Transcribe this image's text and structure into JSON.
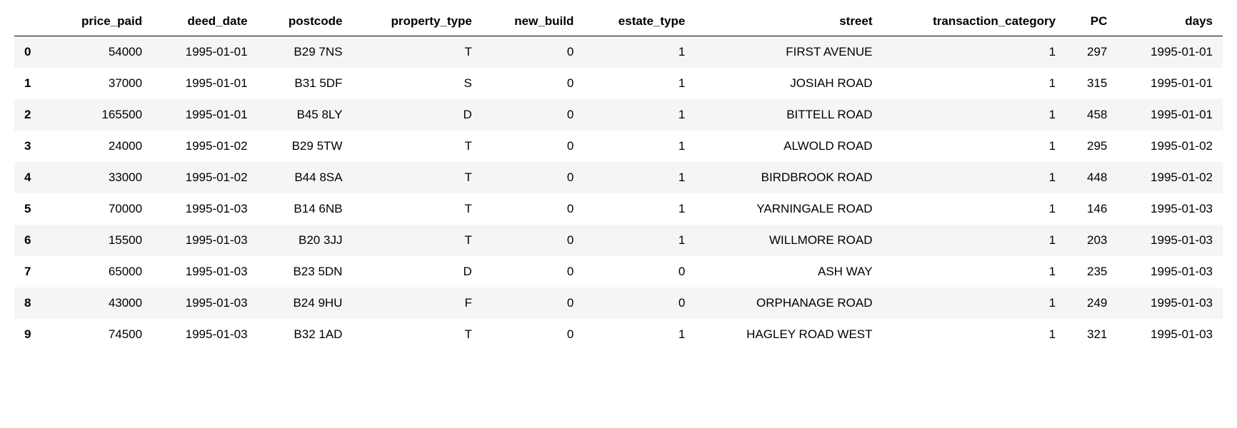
{
  "table": {
    "columns": [
      "",
      "price_paid",
      "deed_date",
      "postcode",
      "property_type",
      "new_build",
      "estate_type",
      "street",
      "transaction_category",
      "PC",
      "days"
    ],
    "rows": [
      {
        "idx": "0",
        "price_paid": "54000",
        "deed_date": "1995-01-01",
        "postcode": "B29 7NS",
        "property_type": "T",
        "new_build": "0",
        "estate_type": "1",
        "street": "FIRST AVENUE",
        "transaction_category": "1",
        "PC": "297",
        "days": "1995-01-01"
      },
      {
        "idx": "1",
        "price_paid": "37000",
        "deed_date": "1995-01-01",
        "postcode": "B31 5DF",
        "property_type": "S",
        "new_build": "0",
        "estate_type": "1",
        "street": "JOSIAH ROAD",
        "transaction_category": "1",
        "PC": "315",
        "days": "1995-01-01"
      },
      {
        "idx": "2",
        "price_paid": "165500",
        "deed_date": "1995-01-01",
        "postcode": "B45 8LY",
        "property_type": "D",
        "new_build": "0",
        "estate_type": "1",
        "street": "BITTELL ROAD",
        "transaction_category": "1",
        "PC": "458",
        "days": "1995-01-01"
      },
      {
        "idx": "3",
        "price_paid": "24000",
        "deed_date": "1995-01-02",
        "postcode": "B29 5TW",
        "property_type": "T",
        "new_build": "0",
        "estate_type": "1",
        "street": "ALWOLD ROAD",
        "transaction_category": "1",
        "PC": "295",
        "days": "1995-01-02"
      },
      {
        "idx": "4",
        "price_paid": "33000",
        "deed_date": "1995-01-02",
        "postcode": "B44 8SA",
        "property_type": "T",
        "new_build": "0",
        "estate_type": "1",
        "street": "BIRDBROOK ROAD",
        "transaction_category": "1",
        "PC": "448",
        "days": "1995-01-02"
      },
      {
        "idx": "5",
        "price_paid": "70000",
        "deed_date": "1995-01-03",
        "postcode": "B14 6NB",
        "property_type": "T",
        "new_build": "0",
        "estate_type": "1",
        "street": "YARNINGALE ROAD",
        "transaction_category": "1",
        "PC": "146",
        "days": "1995-01-03"
      },
      {
        "idx": "6",
        "price_paid": "15500",
        "deed_date": "1995-01-03",
        "postcode": "B20 3JJ",
        "property_type": "T",
        "new_build": "0",
        "estate_type": "1",
        "street": "WILLMORE ROAD",
        "transaction_category": "1",
        "PC": "203",
        "days": "1995-01-03"
      },
      {
        "idx": "7",
        "price_paid": "65000",
        "deed_date": "1995-01-03",
        "postcode": "B23 5DN",
        "property_type": "D",
        "new_build": "0",
        "estate_type": "0",
        "street": "ASH WAY",
        "transaction_category": "1",
        "PC": "235",
        "days": "1995-01-03"
      },
      {
        "idx": "8",
        "price_paid": "43000",
        "deed_date": "1995-01-03",
        "postcode": "B24 9HU",
        "property_type": "F",
        "new_build": "0",
        "estate_type": "0",
        "street": "ORPHANAGE ROAD",
        "transaction_category": "1",
        "PC": "249",
        "days": "1995-01-03"
      },
      {
        "idx": "9",
        "price_paid": "74500",
        "deed_date": "1995-01-03",
        "postcode": "B32 1AD",
        "property_type": "T",
        "new_build": "0",
        "estate_type": "1",
        "street": "HAGLEY ROAD WEST",
        "transaction_category": "1",
        "PC": "321",
        "days": "1995-01-03"
      }
    ]
  }
}
